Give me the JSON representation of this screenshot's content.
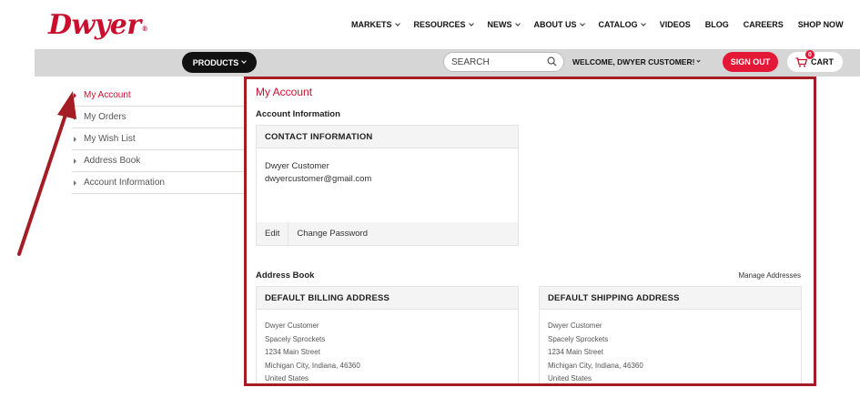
{
  "brand": {
    "logo_text": "Dwyer",
    "logo_mark": "®",
    "accent_color": "#c8102e"
  },
  "top_nav": [
    {
      "label": "MARKETS",
      "has_dropdown": true
    },
    {
      "label": "RESOURCES",
      "has_dropdown": true
    },
    {
      "label": "NEWS",
      "has_dropdown": true
    },
    {
      "label": "ABOUT US",
      "has_dropdown": true
    },
    {
      "label": "CATALOG",
      "has_dropdown": true
    },
    {
      "label": "VIDEOS",
      "has_dropdown": false
    },
    {
      "label": "BLOG",
      "has_dropdown": false
    },
    {
      "label": "CAREERS",
      "has_dropdown": false
    },
    {
      "label": "SHOP NOW",
      "has_dropdown": false
    }
  ],
  "toolbar": {
    "products_label": "PRODUCTS",
    "search_placeholder": "SEARCH",
    "welcome_text": "WELCOME, DWYER CUSTOMER!",
    "sign_out_label": "SIGN OUT",
    "cart_label": "CART",
    "cart_count": "0"
  },
  "sidebar": {
    "items": [
      {
        "label": "My Account",
        "active": true
      },
      {
        "label": "My Orders",
        "active": false
      },
      {
        "label": "My Wish List",
        "active": false
      },
      {
        "label": "Address Book",
        "active": false
      },
      {
        "label": "Account Information",
        "active": false
      }
    ]
  },
  "main": {
    "page_title": "My Account",
    "account_info_title": "Account Information",
    "contact": {
      "heading": "CONTACT INFORMATION",
      "name": "Dwyer Customer",
      "email": "dwyercustomer@gmail.com",
      "edit_label": "Edit",
      "change_password_label": "Change Password"
    },
    "address_book_title": "Address Book",
    "manage_addresses_label": "Manage Addresses",
    "billing": {
      "heading": "DEFAULT BILLING ADDRESS",
      "lines": [
        "Dwyer Customer",
        "Spacely Sprockets",
        "1234 Main Street",
        "Michigan City, Indiana, 46360",
        "United States"
      ]
    },
    "shipping": {
      "heading": "DEFAULT SHIPPING ADDRESS",
      "lines": [
        "Dwyer Customer",
        "Spacely Sprockets",
        "1234 Main Street",
        "Michigan City, Indiana, 46360",
        "United States"
      ]
    }
  },
  "annotation": {
    "frame_color": "#a51d24",
    "arrow_color": "#a51d24"
  }
}
